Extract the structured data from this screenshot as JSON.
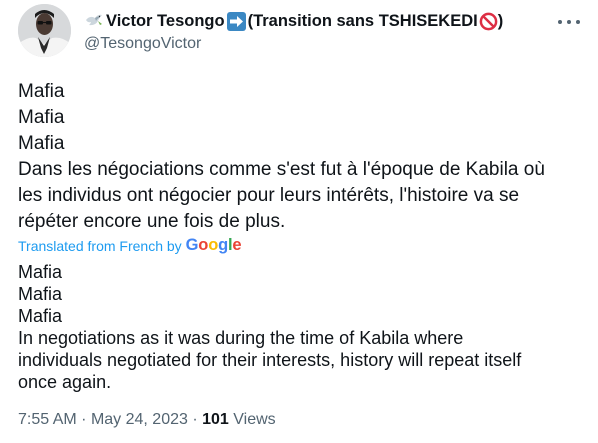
{
  "tweet": {
    "display_name": "Victor Tesongo",
    "display_name_suffix": "(Transition sans TSHISEKEDI",
    "display_name_close": ")",
    "handle": "@TesongoVictor",
    "original_lines": [
      "Mafia",
      "Mafia",
      "Mafia",
      "Dans les négociations comme s'est fut à l'époque de Kabila où",
      "les individus ont négocier pour leurs intérêts, l'histoire va se",
      "répéter encore une fois de plus."
    ],
    "translated_from_label": "Translated from French by",
    "translator_logo": "Google",
    "translation_lines": [
      "Mafia",
      "Mafia",
      "Mafia",
      "In negotiations as it was during the time of Kabila where",
      "individuals negotiated for their interests, history will repeat itself",
      "once again."
    ],
    "time": "7:55 AM",
    "date": "May 24, 2023",
    "separator": "·",
    "views_count": "101",
    "views_label": "Views"
  },
  "icons": {
    "name_prefix": "dove-of-peace-icon",
    "arrow": "right-arrow-icon",
    "prohibited": "prohibited-icon",
    "more": "more-icon"
  },
  "colors": {
    "text_primary": "#0f1419",
    "text_secondary": "#536471",
    "link": "#1d9bf0"
  }
}
